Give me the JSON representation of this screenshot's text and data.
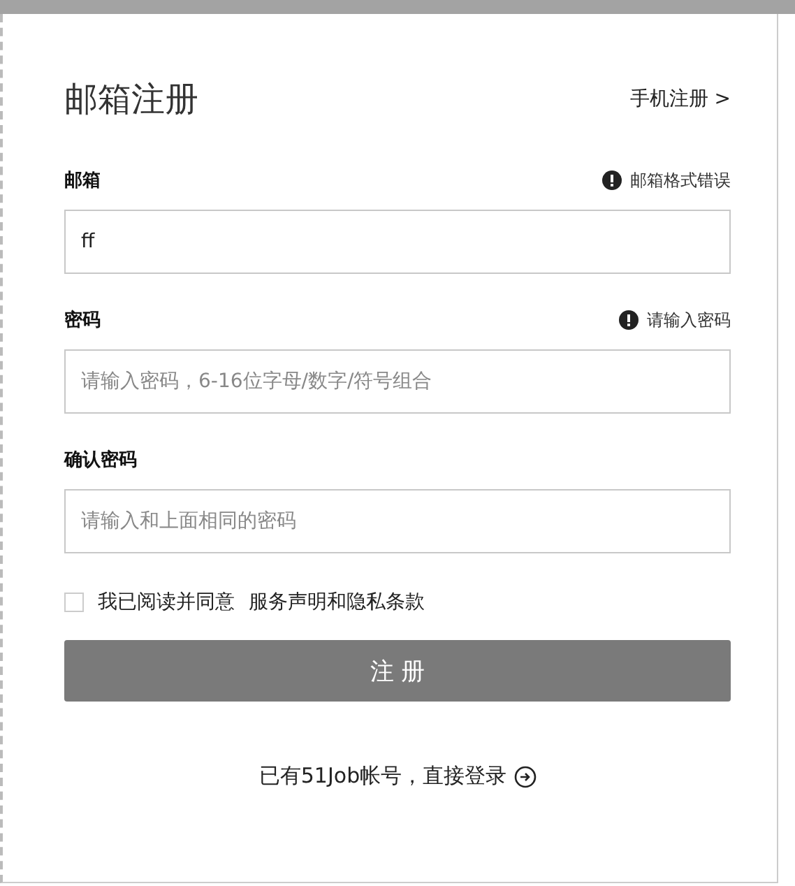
{
  "title": "邮箱注册",
  "switch_link": "手机注册 >",
  "fields": [
    {
      "label": "邮箱",
      "error": "邮箱格式错误",
      "value": "ff"
    },
    {
      "label": "密码",
      "error": "请输入密码",
      "placeholder": "请输入密码，6-16位字母/数字/符号组合"
    },
    {
      "label": "确认密码",
      "placeholder": "请输入和上面相同的密码"
    }
  ],
  "agreement": {
    "checked": false,
    "text": "我已阅读并同意",
    "link": "服务声明和隐私条款"
  },
  "submit": "注 册",
  "footer_link": "已有51Job帐号，直接登录"
}
